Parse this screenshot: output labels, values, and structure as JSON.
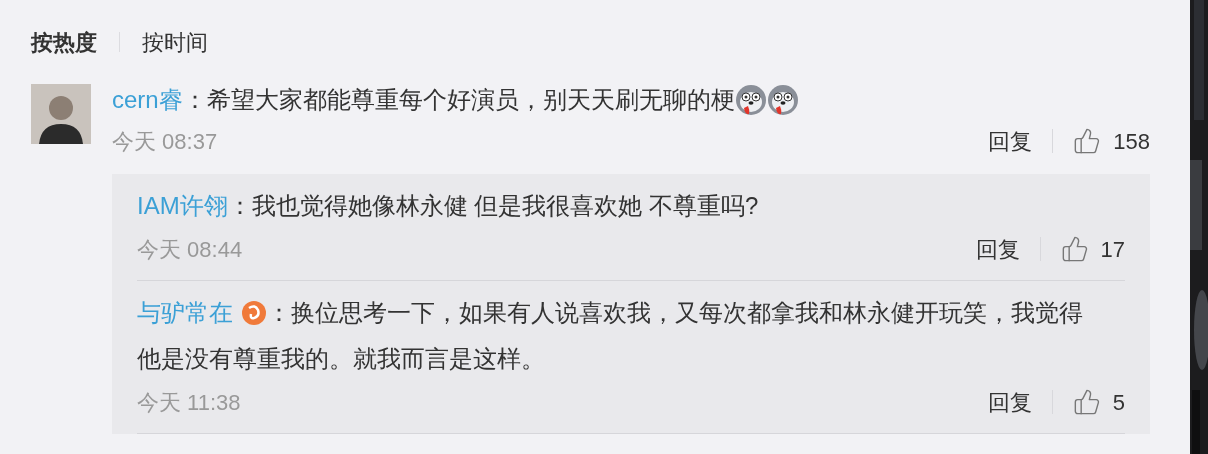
{
  "sort_tabs": [
    {
      "label": "按热度",
      "selected": true
    },
    {
      "label": "按时间",
      "selected": false
    }
  ],
  "comment": {
    "user": "cern睿",
    "separator": "：",
    "text": "希望大家都能尊重每个好演员，别天天刷无聊的梗",
    "time": "今天 08:37",
    "reply_label": "回复",
    "likes": "158",
    "replies": [
      {
        "user": "IAM许翎",
        "badge": false,
        "separator": "：",
        "text": "我也觉得她像林永健 但是我很喜欢她 不尊重吗?",
        "time": "今天 08:44",
        "reply_label": "回复",
        "likes": "17"
      },
      {
        "user": "与驴常在",
        "badge": true,
        "separator": "：",
        "text": "换位思考一下，如果有人说喜欢我，又每次都拿我和林永健开玩笑，我觉得他是没有尊重我的。就我而言是这样。",
        "time": "今天 11:38",
        "reply_label": "回复",
        "likes": "5"
      }
    ]
  }
}
